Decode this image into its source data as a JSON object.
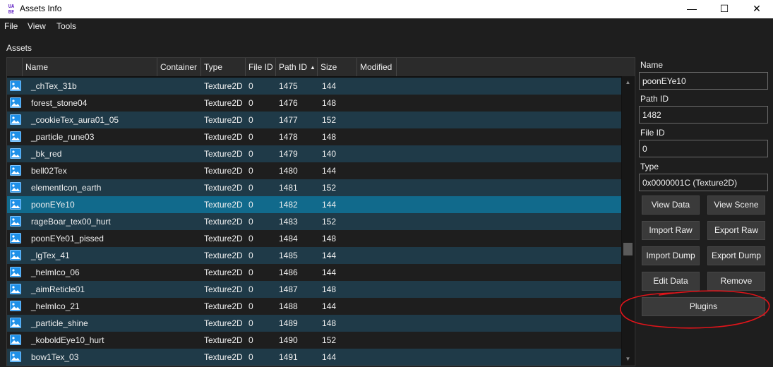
{
  "window": {
    "title": "Assets Info",
    "app_icon_text": "UABE",
    "controls": {
      "minimize": "—",
      "maximize": "☐",
      "close": "✕"
    }
  },
  "menu": {
    "items": [
      "File",
      "View",
      "Tools"
    ]
  },
  "assets": {
    "label": "Assets",
    "columns": [
      "Name",
      "Container",
      "Type",
      "File ID",
      "Path ID",
      "Size",
      "Modified"
    ],
    "sorted_column": "Path ID",
    "sort_direction": "ascending",
    "sort_glyph": "▲",
    "rows": [
      {
        "name": "_chTex_31b",
        "container": "",
        "type": "Texture2D",
        "file_id": "0",
        "path_id": "1475",
        "size": "144",
        "modified": ""
      },
      {
        "name": "forest_stone04",
        "container": "",
        "type": "Texture2D",
        "file_id": "0",
        "path_id": "1476",
        "size": "148",
        "modified": ""
      },
      {
        "name": "_cookieTex_aura01_05",
        "container": "",
        "type": "Texture2D",
        "file_id": "0",
        "path_id": "1477",
        "size": "152",
        "modified": ""
      },
      {
        "name": "_particle_rune03",
        "container": "",
        "type": "Texture2D",
        "file_id": "0",
        "path_id": "1478",
        "size": "148",
        "modified": ""
      },
      {
        "name": "_bk_red",
        "container": "",
        "type": "Texture2D",
        "file_id": "0",
        "path_id": "1479",
        "size": "140",
        "modified": ""
      },
      {
        "name": "bell02Tex",
        "container": "",
        "type": "Texture2D",
        "file_id": "0",
        "path_id": "1480",
        "size": "144",
        "modified": ""
      },
      {
        "name": "elementIcon_earth",
        "container": "",
        "type": "Texture2D",
        "file_id": "0",
        "path_id": "1481",
        "size": "152",
        "modified": ""
      },
      {
        "name": "poonEYe10",
        "container": "",
        "type": "Texture2D",
        "file_id": "0",
        "path_id": "1482",
        "size": "144",
        "modified": "",
        "selected": true
      },
      {
        "name": "rageBoar_tex00_hurt",
        "container": "",
        "type": "Texture2D",
        "file_id": "0",
        "path_id": "1483",
        "size": "152",
        "modified": ""
      },
      {
        "name": "poonEYe01_pissed",
        "container": "",
        "type": "Texture2D",
        "file_id": "0",
        "path_id": "1484",
        "size": "148",
        "modified": ""
      },
      {
        "name": "_lgTex_41",
        "container": "",
        "type": "Texture2D",
        "file_id": "0",
        "path_id": "1485",
        "size": "144",
        "modified": ""
      },
      {
        "name": "_helmIco_06",
        "container": "",
        "type": "Texture2D",
        "file_id": "0",
        "path_id": "1486",
        "size": "144",
        "modified": ""
      },
      {
        "name": "_aimReticle01",
        "container": "",
        "type": "Texture2D",
        "file_id": "0",
        "path_id": "1487",
        "size": "148",
        "modified": ""
      },
      {
        "name": "_helmIco_21",
        "container": "",
        "type": "Texture2D",
        "file_id": "0",
        "path_id": "1488",
        "size": "144",
        "modified": ""
      },
      {
        "name": "_particle_shine",
        "container": "",
        "type": "Texture2D",
        "file_id": "0",
        "path_id": "1489",
        "size": "148",
        "modified": ""
      },
      {
        "name": "_koboldEye10_hurt",
        "container": "",
        "type": "Texture2D",
        "file_id": "0",
        "path_id": "1490",
        "size": "152",
        "modified": ""
      },
      {
        "name": "bow1Tex_03",
        "container": "",
        "type": "Texture2D",
        "file_id": "0",
        "path_id": "1491",
        "size": "144",
        "modified": ""
      }
    ],
    "row_icon": "image-icon"
  },
  "details": {
    "name_label": "Name",
    "name_value": "poonEYe10",
    "path_id_label": "Path ID",
    "path_id_value": "1482",
    "file_id_label": "File ID",
    "file_id_value": "0",
    "type_label": "Type",
    "type_value": "0x0000001C (Texture2D)"
  },
  "buttons": {
    "view_data": "View Data",
    "view_scene": "View Scene",
    "import_raw": "Import Raw",
    "export_raw": "Export Raw",
    "import_dump": "Import Dump",
    "export_dump": "Export Dump",
    "edit_data": "Edit Data",
    "remove": "Remove",
    "plugins": "Plugins"
  },
  "colors": {
    "background": "#1e1e1e",
    "row_alt": "#1f3a48",
    "row_selected": "#116a8c",
    "icon_blue": "#1e90e8",
    "annotation_red": "#e0141a"
  }
}
